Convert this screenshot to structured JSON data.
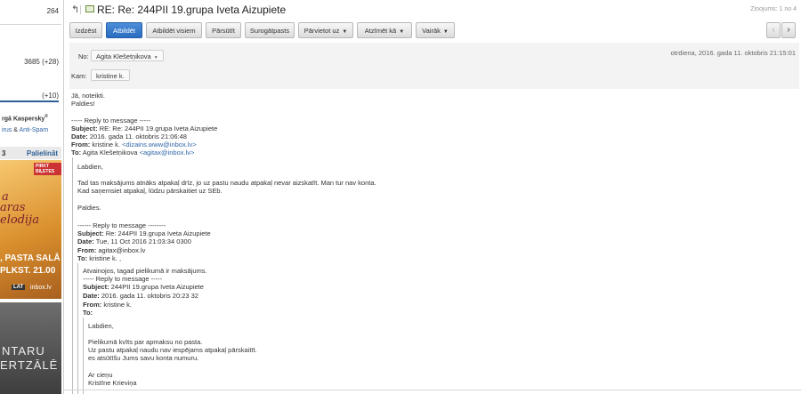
{
  "sidebar": {
    "count_1": "264",
    "count_2": "3685 (+28)",
    "count_3": "(+10)",
    "promo_title": "rgā Kaspersky",
    "promo_sup": "®",
    "promo_line_part1": "irus",
    "promo_line_amp": "&",
    "promo_line_part2": "Anti-Spam",
    "ad_left_label": "3",
    "ad_enlarge": "Palielināt",
    "ad1": {
      "badge": "PIRKT BIĻETES",
      "line1": "a",
      "line2": "aras",
      "line3": "elodija",
      "line4": ", PASTA SALĀ",
      "line5": "PLKST. 21.00",
      "brand": "LAT",
      "brand2": "inbox.lv"
    },
    "ad2": {
      "line1": "NTARU",
      "line2": "ERTZĀLĒ"
    }
  },
  "titlebar": {
    "title": "RE: Re: 244PII 19.grupa Iveta Aizupiete",
    "counter": "Ziņojums: 1 no 4"
  },
  "toolbar": {
    "delete": "Izdzēst",
    "reply": "Atbildēt",
    "reply_all": "Atbildēt visiem",
    "forward": "Pārsūtīt",
    "spam": "Surogātpasts",
    "move": "Pārvietot uz",
    "mark": "Atzīmēt kā",
    "more": "Vairāk",
    "prev": "‹",
    "next": "›"
  },
  "header": {
    "from_label": "No:",
    "from_value": "Agita Klešetņikova",
    "to_label": "Kam:",
    "to_value": "kristine k.",
    "date": "otrdiena, 2016. gada 11. oktobris 21:15:01"
  },
  "message": {
    "line1": "Jā, noteikti.",
    "line2": "Paldies!",
    "q1": {
      "sep": "----- Reply to message -----",
      "subject_label": "Subject:",
      "subject": "RE: Re: 244PII 19.grupa Iveta Aizupiete",
      "date_label": "Date:",
      "date": "2016. gada 11. oktobris 21:06:48",
      "from_label": "From:",
      "from": "kristine k.",
      "from_email": "<dizains.www@inbox.lv>",
      "to_label": "To:",
      "to": "Agita Klešetņikova",
      "to_email": "<agitax@inbox.lv>",
      "p1": "Labdien,",
      "p2": "Tad tas maksājums atnāks atpakaļ drīz, jo uz pastu naudu atpakaļ nevar aizskatīt. Man tur nav konta.",
      "p3": "Kad saņemsiet atpakaļ, lūdzu pārskaitiet uz SEb.",
      "p4": "Paldies."
    },
    "q2": {
      "sep": "------ Reply to message --------",
      "subject_label": "Subject:",
      "subject": "Re: 244PII 19.grupa Iveta Aizupiete",
      "date_label": "Date:",
      "date": "Tue, 11 Oct 2016 21:03:34 0300",
      "from_label": "From:",
      "from": "agitax@inbox.lv",
      "to_label": "To:",
      "to": "kristine k. ,"
    },
    "q3": {
      "p1": "Atvainojos, tagad pielikumā ir maksājums.",
      "sep": "----- Reply to message -----",
      "subject_label": "Subject:",
      "subject": "244PII 19.grupa Iveta Aizupiete",
      "date_label": "Date:",
      "date": "2016. gada 11. oktobris 20:23 32",
      "from_label": "From:",
      "from": "kristine k.",
      "to_label": "To:"
    },
    "q4": {
      "p1": "Labdien,",
      "p2": "Pielikumā kvīts par apmaksu no pasta.",
      "p3": "Uz pastu atpakaļ naudu nav iespējams atpakaļ pārskaitīt.",
      "p4": "es atsūtīšu Jums savu konta numuru.",
      "p5": "Ar cieņu",
      "p6": "Kristīne Krieviņa"
    }
  }
}
